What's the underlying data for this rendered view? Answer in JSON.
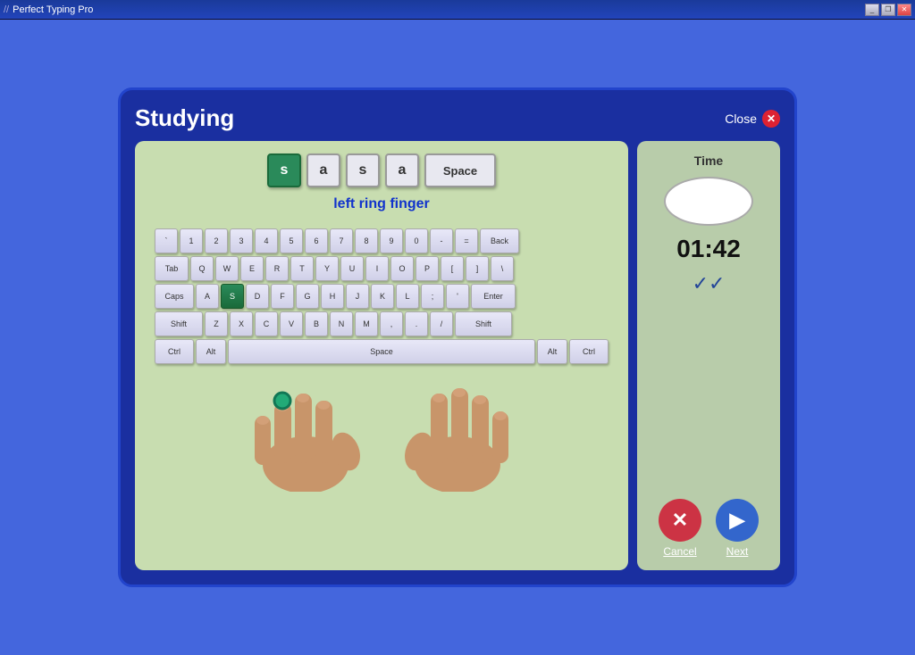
{
  "titlebar": {
    "title": "Perfect Typing Pro",
    "minimize_label": "_",
    "restore_label": "❐",
    "close_label": "✕"
  },
  "panel": {
    "title": "Studying",
    "close_label": "Close"
  },
  "key_sequence": [
    {
      "id": "key-s1",
      "label": "s",
      "active": true
    },
    {
      "id": "key-a1",
      "label": "a",
      "active": false
    },
    {
      "id": "key-s2",
      "label": "s",
      "active": false
    },
    {
      "id": "key-a2",
      "label": "a",
      "active": false
    },
    {
      "id": "key-space",
      "label": "Space",
      "active": false
    }
  ],
  "finger_label": "left ring finger",
  "time_label": "Time",
  "time_display": "01:42",
  "checkmarks": "✓✓",
  "buttons": {
    "cancel": "Cancel",
    "next": "Next"
  },
  "keyboard": {
    "row1": [
      "`",
      "1",
      "2",
      "3",
      "4",
      "5",
      "6",
      "7",
      "8",
      "9",
      "0",
      "-",
      "=",
      "Back"
    ],
    "row2": [
      "Tab",
      "Q",
      "W",
      "E",
      "R",
      "T",
      "Y",
      "U",
      "I",
      "O",
      "P",
      "[",
      "]",
      "\\"
    ],
    "row3": [
      "Caps",
      "A",
      "S",
      "D",
      "F",
      "G",
      "H",
      "J",
      "K",
      "L",
      ";",
      "'",
      "Enter"
    ],
    "row4": [
      "Shift",
      "Z",
      "X",
      "C",
      "V",
      "B",
      "N",
      "M",
      ",",
      ".",
      "/",
      "Shift"
    ],
    "row5": [
      "Ctrl",
      "Alt",
      "Space",
      "Alt",
      "Ctrl"
    ]
  },
  "highlighted_key": "S"
}
